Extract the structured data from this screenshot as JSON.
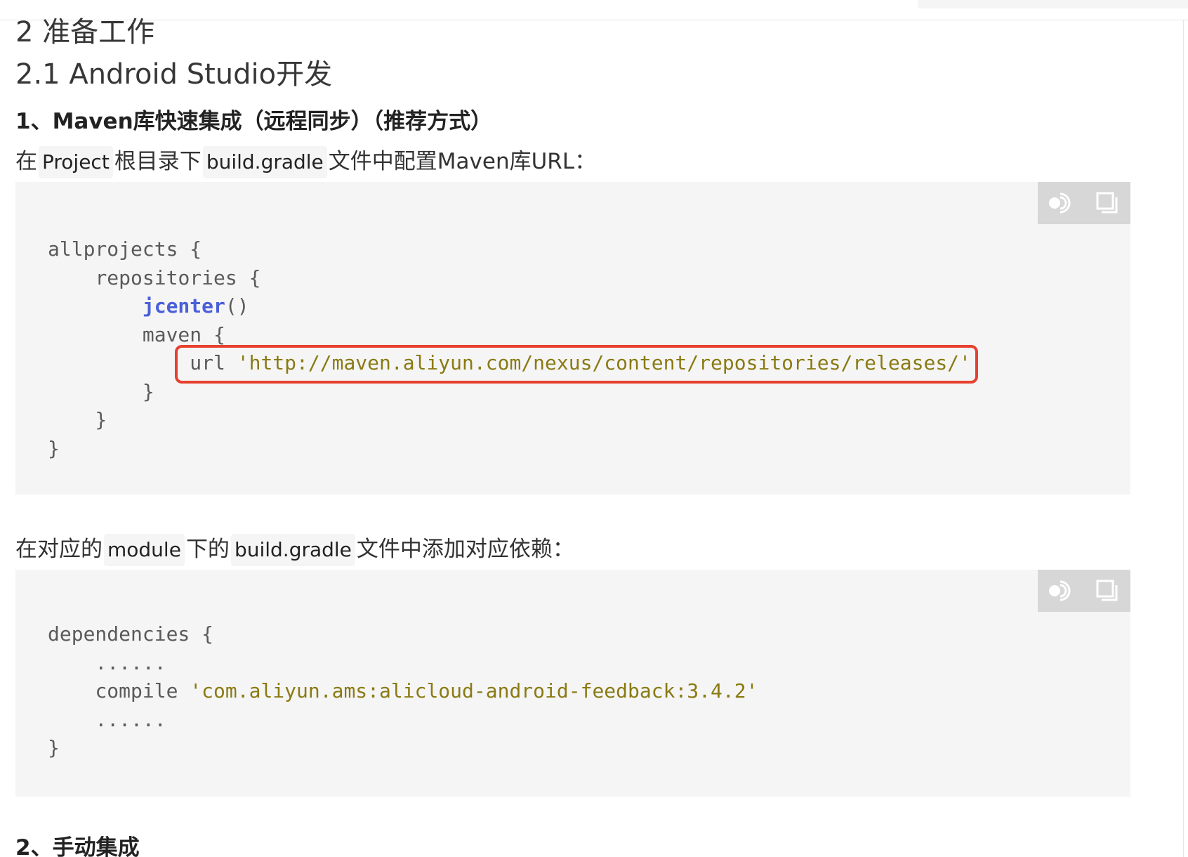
{
  "headings": {
    "h2": "2 准备工作",
    "h3": "2.1 Android Studio开发",
    "h4": "1、Maven库快速集成（远程同步）（推荐方式）",
    "h5": "2、手动集成"
  },
  "para1": {
    "t1": "在",
    "c1": "Project",
    "t2": "根目录下",
    "c2": "build.gradle",
    "t3": "文件中配置Maven库URL："
  },
  "para2": {
    "t1": "在对应的",
    "c1": "module",
    "t2": "下的",
    "c2": "build.gradle",
    "t3": "文件中添加对应依赖："
  },
  "code1": {
    "l1": "allprojects {",
    "l2_indent": "    ",
    "l2": "repositories {",
    "l3_indent": "        ",
    "l3_kw": "jcenter",
    "l3_rest": "()",
    "l4_indent": "        ",
    "l4": "maven {",
    "l5_indent": "            ",
    "l5_kw": "url ",
    "l5_str": "'http://maven.aliyun.com/nexus/content/repositories/releases/'",
    "l6": "        }",
    "l7": "    }",
    "l8": "}"
  },
  "code2": {
    "l1": "dependencies {",
    "l2": "    ......",
    "l3_indent": "    ",
    "l3_kw": "compile ",
    "l3_str": "'com.aliyun.ams:alicloud-android-feedback:3.4.2'",
    "l4": "    ......",
    "l5": "}"
  },
  "icons": {
    "theme_toggle": "theme-toggle-icon",
    "copy": "copy-icon"
  },
  "colors": {
    "highlight_border": "#e8402f",
    "keyword": "#4b5fd9",
    "string": "#8a7a13",
    "code_background": "#f5f5f5",
    "toolbar_background": "#d7d7d7"
  }
}
